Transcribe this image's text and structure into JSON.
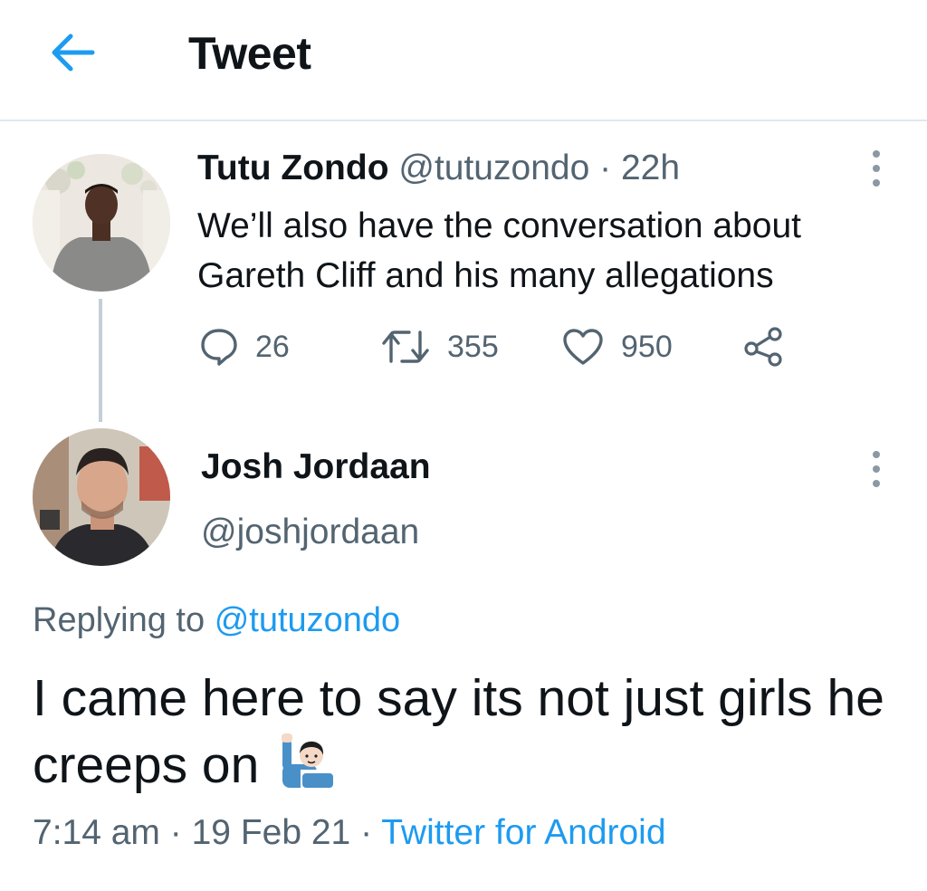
{
  "header": {
    "title": "Tweet",
    "back_icon": "back-arrow-icon",
    "accent": "#1d9bf0"
  },
  "parent_tweet": {
    "name": "Tutu Zondo",
    "handle": "@tutuzondo",
    "sep": "·",
    "time": "22h",
    "text": "We’ll also have the conversation about Gareth Cliff and his many allegations",
    "actions": {
      "replies": "26",
      "retweets": "355",
      "likes": "950"
    }
  },
  "reply_tweet": {
    "name": "Josh Jordaan",
    "handle": "@joshjordaan",
    "replying_prefix": "Replying to",
    "replying_to": "@tutuzondo",
    "text": "I came here to say its not just girls he creeps on",
    "emoji": "person-raising-hand-icon",
    "time": "7:14 am",
    "date": "19 Feb 21",
    "sep": "·",
    "source": "Twitter for Android"
  }
}
